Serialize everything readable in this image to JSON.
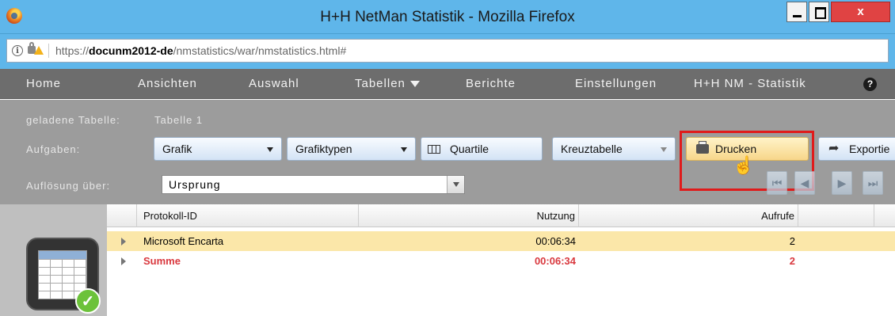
{
  "window": {
    "title": "H+H NetMan Statistik - Mozilla Firefox",
    "close_label": "x"
  },
  "urlbar": {
    "prefix": "https://",
    "domain": "docunm2012-de",
    "path": "/nmstatistics/war/nmstatistics.html#",
    "info_glyph": "i"
  },
  "nav": {
    "items": [
      "Home",
      "Ansichten",
      "Auswahl",
      "Tabellen",
      "Berichte",
      "Einstellungen",
      "H+H NM - Statistik"
    ],
    "help_glyph": "?"
  },
  "panel": {
    "loaded_label": "geladene Tabelle:",
    "loaded_value": "Tabelle 1",
    "tasks_label": "Aufgaben:",
    "resolution_label": "Auflösung über:",
    "resolution_value": "Ursprung",
    "buttons": {
      "grafik": "Grafik",
      "grafiktypen": "Grafiktypen",
      "quartile": "Quartile",
      "kreuztabelle": "Kreuztabelle",
      "drucken": "Drucken",
      "exportieren": "Exportie"
    }
  },
  "table": {
    "columns": [
      "Protokoll-ID",
      "Nutzung",
      "Aufrufe"
    ],
    "rows": [
      {
        "id": "Microsoft Encarta",
        "nutzung": "00:06:34",
        "aufrufe": "2"
      },
      {
        "id": "Summe",
        "nutzung": "00:06:34",
        "aufrufe": "2"
      }
    ]
  },
  "colors": {
    "titlebar": "#5fb6ea",
    "nav": "#6d6d6d",
    "panel": "#9c9c9c",
    "highlight": "#e01b1b",
    "selected_row": "#fbe7a9",
    "sum_text": "#d9383e"
  }
}
